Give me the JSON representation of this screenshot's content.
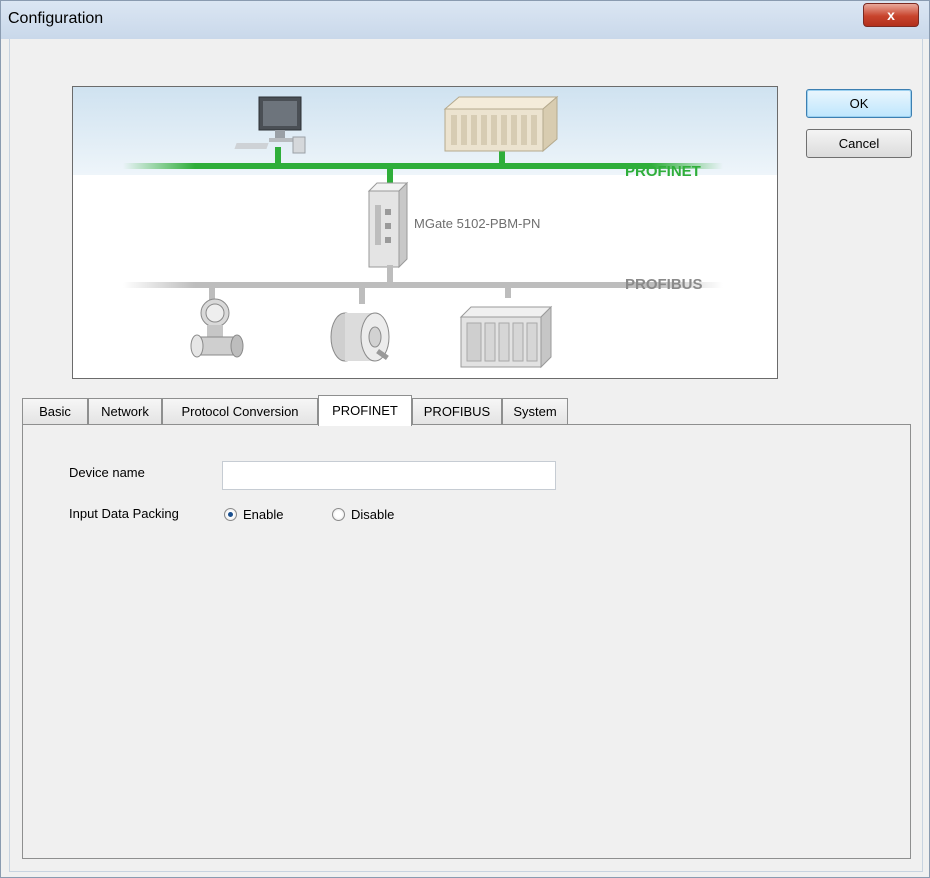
{
  "window": {
    "title": "Configuration",
    "close_label": "x"
  },
  "buttons": {
    "ok": "OK",
    "cancel": "Cancel"
  },
  "diagram": {
    "profinet_label": "PROFINET",
    "profibus_label": "PROFIBUS",
    "gateway_label": "MGate 5102-PBM-PN",
    "colors": {
      "profinet": "#2fae3a",
      "profibus": "#bdbdbd",
      "profinet_text": "#2fae3a",
      "profibus_text": "#8a8a8a"
    }
  },
  "tabs": [
    {
      "label": "Basic",
      "active": false
    },
    {
      "label": "Network",
      "active": false
    },
    {
      "label": "Protocol Conversion",
      "active": false
    },
    {
      "label": "PROFINET",
      "active": true
    },
    {
      "label": "PROFIBUS",
      "active": false
    },
    {
      "label": "System",
      "active": false
    }
  ],
  "form": {
    "device_name_label": "Device name",
    "device_name_value": "",
    "input_packing_label": "Input Data Packing",
    "enable_label": "Enable",
    "disable_label": "Disable",
    "selected": "Enable"
  }
}
